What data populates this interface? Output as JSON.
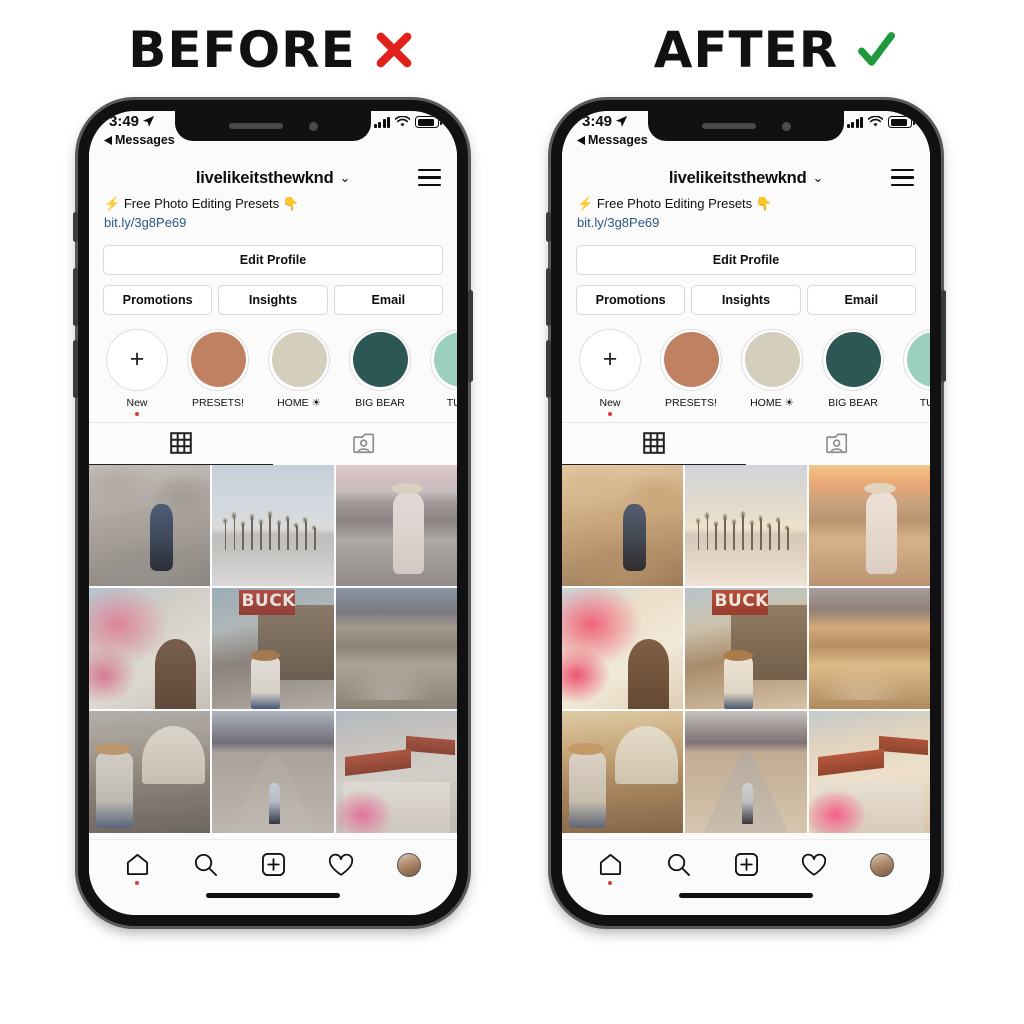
{
  "headings": {
    "before": {
      "label": "BEFORE",
      "mark": "cross-icon",
      "mark_color": "#E0201B"
    },
    "after": {
      "label": "AFTER",
      "mark": "check-icon",
      "mark_color": "#1E9A3C"
    }
  },
  "status_bar": {
    "time": "3:49",
    "location_icon": "location-arrow-icon",
    "back_label": "Messages",
    "back_icon": "back-triangle-icon",
    "signal_icon": "cellular-bars-icon",
    "wifi_icon": "wifi-icon",
    "battery_icon": "battery-icon"
  },
  "profile": {
    "username": "livelikeitsthewknd",
    "username_chevron": "chevron-down-icon",
    "menu_icon": "hamburger-menu-icon",
    "bio_emoji_left": "⚡",
    "bio_text": "Free Photo Editing Presets",
    "bio_emoji_right": "👇",
    "bio_link": "bit.ly/3g8Pe69"
  },
  "action_buttons": {
    "edit_profile": "Edit Profile",
    "promotions": "Promotions",
    "insights": "Insights",
    "email": "Email"
  },
  "highlights": [
    {
      "label": "New",
      "type": "new",
      "icon": "plus-icon",
      "color": "#ffffff",
      "has_dot": true
    },
    {
      "label": "PRESETS!",
      "type": "cover",
      "color": "#C08163",
      "has_dot": false
    },
    {
      "label": "HOME ☀",
      "type": "cover",
      "color": "#D4CEBD",
      "has_dot": false
    },
    {
      "label": "BIG BEAR",
      "type": "cover",
      "color": "#2C5754",
      "has_dot": false
    },
    {
      "label": "TUNE",
      "type": "cover",
      "color": "#9BCFBF",
      "has_dot": false
    }
  ],
  "content_tabs": [
    {
      "name": "grid-tab",
      "icon": "grid-icon",
      "active": true
    },
    {
      "name": "tagged-tab",
      "icon": "tagged-person-icon",
      "active": false
    }
  ],
  "bottom_nav": [
    {
      "name": "home",
      "icon": "home-icon",
      "has_dot": true
    },
    {
      "name": "search",
      "icon": "search-icon",
      "has_dot": false
    },
    {
      "name": "add",
      "icon": "plus-square-icon",
      "has_dot": false
    },
    {
      "name": "likes",
      "icon": "heart-icon",
      "has_dot": false
    },
    {
      "name": "profile",
      "icon": "avatar-icon",
      "has_dot": false
    }
  ],
  "photo_grid": {
    "before_tone": "cool-muted",
    "after_tone": "warm-golden",
    "photos": [
      {
        "id": "rocks",
        "caption": "woman walking on boulders at joshua tree"
      },
      {
        "id": "palms",
        "caption": "row of palm trees at dusk by the ocean"
      },
      {
        "id": "beach",
        "caption": "woman in white dress and hat on beach"
      },
      {
        "id": "flower",
        "caption": "pink bougainvillea over white arch door"
      },
      {
        "id": "buck",
        "caption": "woman in hat at rustic BUCK bar exterior"
      },
      {
        "id": "dunes",
        "caption": "sand dunes with mountain ridge"
      },
      {
        "id": "wagon",
        "caption": "woman by covered wagon at sunset"
      },
      {
        "id": "road",
        "caption": "woman standing on empty desert road"
      },
      {
        "id": "roof",
        "caption": "spanish tile roofs with pink blossoms"
      }
    ],
    "sign_text": "BUCK"
  },
  "phone_chrome": {
    "notch": "notch",
    "speaker": "earpiece-speaker",
    "camera": "front-camera",
    "home_indicator": "home-indicator-bar",
    "side_buttons": [
      "mute-switch",
      "volume-up-button",
      "volume-down-button",
      "power-button"
    ]
  }
}
